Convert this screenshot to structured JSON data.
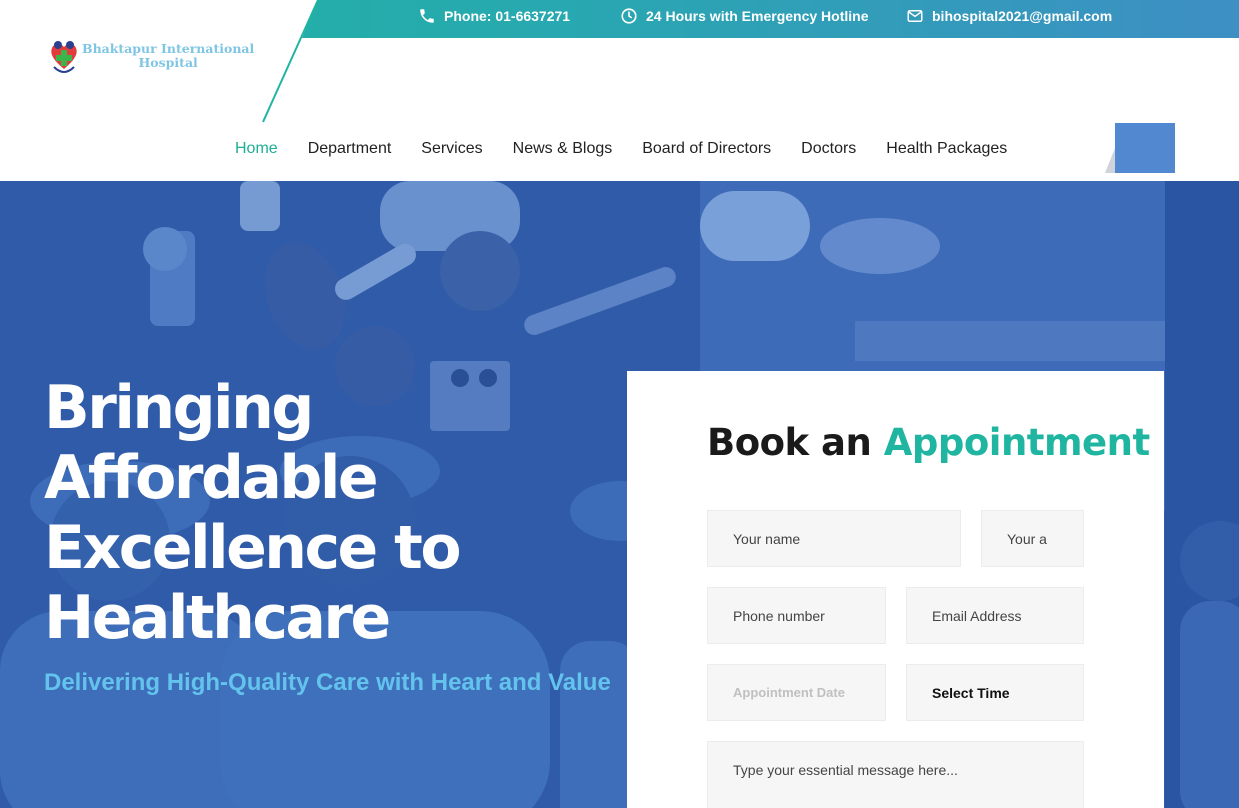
{
  "topbar": {
    "phone": "Phone: 01-6637271",
    "hours": "24 Hours with Emergency Hotline",
    "email": "bihospital2021@gmail.com"
  },
  "logo": {
    "line1": "Bhaktapur International",
    "line2": "Hospital"
  },
  "nav": {
    "items": [
      {
        "label": "Home",
        "active": true
      },
      {
        "label": "Department"
      },
      {
        "label": "Services"
      },
      {
        "label": "News & Blogs"
      },
      {
        "label": "Board of Directors"
      },
      {
        "label": "Doctors"
      },
      {
        "label": "Health Packages"
      }
    ]
  },
  "hero": {
    "title_lines": [
      "Bringing",
      "Affordable",
      "Excellence to",
      "Healthcare"
    ],
    "subtitle": "Delivering High-Quality Care with Heart and Value"
  },
  "form": {
    "title_part1": "Book an",
    "title_part2": "Appointment",
    "name_placeholder": "Your name",
    "address_placeholder": "Your a",
    "phone_placeholder": "Phone number",
    "email_placeholder": "Email Address",
    "date_placeholder": "Appointment Date",
    "time_select": "Select Time",
    "message_placeholder": "Type your essential message here..."
  },
  "colors": {
    "accent": "#1fb5a0",
    "hero_overlay": "#345fae",
    "subtitle": "#63c3ec",
    "cta": "#5288d0"
  }
}
